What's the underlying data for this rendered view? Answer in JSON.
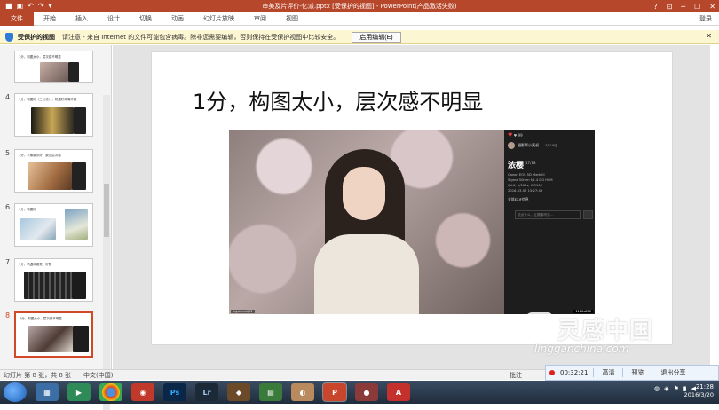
{
  "window": {
    "title": "审美及片评价-亿派.pptx [受保护的视图] - PowerPoint(产品激活失败)",
    "controls": [
      "?",
      "⊡",
      "─",
      "☐",
      "✕"
    ]
  },
  "ribbon": {
    "tabs": [
      "文件",
      "开始",
      "插入",
      "设计",
      "切换",
      "动画",
      "幻灯片放映",
      "审阅",
      "视图"
    ],
    "signin": "登录"
  },
  "protected_view": {
    "title": "受保护的视图",
    "message": "请注意 - 来自 Internet 的文件可能包含病毒。除非您需要编辑，否则保持在受保护视图中比较安全。",
    "button": "启用编辑(E)",
    "close": "✕"
  },
  "thumbnails": [
    {
      "num": "",
      "caption": "1分，构图太小，层次感不明显"
    },
    {
      "num": "4",
      "caption": "1分，构图好（三分法），机遇好和情怀感"
    },
    {
      "num": "5",
      "caption": "1分，人像展示好，缺乏层次感"
    },
    {
      "num": "6",
      "caption": "1分，构图好"
    },
    {
      "num": "7",
      "caption": "1分，机遇和感觉，好照"
    },
    {
      "num": "8",
      "caption": "1分，构图太小，层次感不明显"
    }
  ],
  "slide": {
    "title": "1分，构图太小，层次感不明显",
    "photo_caption": "tuyan.net/01",
    "exif": {
      "top": "♥ 99",
      "author": "摄影师小黄叔",
      "date": "3月16日",
      "title": "浓樱",
      "count": "17/18",
      "lines": [
        "Canon EOS 5D Mark III",
        "Sigma 50mm f/1.4 DG HSM",
        "f/4.0, 1/160s, ISO100",
        "2016-03-07 15:27:49"
      ],
      "link": "全部EXIF信息",
      "comment_placeholder": "说点什么，让摄者听见...",
      "resolution": "1180x800"
    }
  },
  "status": {
    "slide_info": "幻灯片 第 8 张，共 8 张",
    "language": "中文(中国)",
    "notes": "批注"
  },
  "recorder": {
    "time": "00:32:21",
    "buttons": [
      "高清",
      "预览",
      "退出分享"
    ]
  },
  "watermark": {
    "cn": "灵感中国",
    "en": "lingganchina.com"
  },
  "taskbar": {
    "apps": [
      "Ps",
      "Lr",
      "P",
      "A"
    ],
    "time": "21:28",
    "date": "2016/3/20"
  },
  "colors": {
    "ppt_red": "#b7472a",
    "active_slide_border": "#d24726"
  }
}
